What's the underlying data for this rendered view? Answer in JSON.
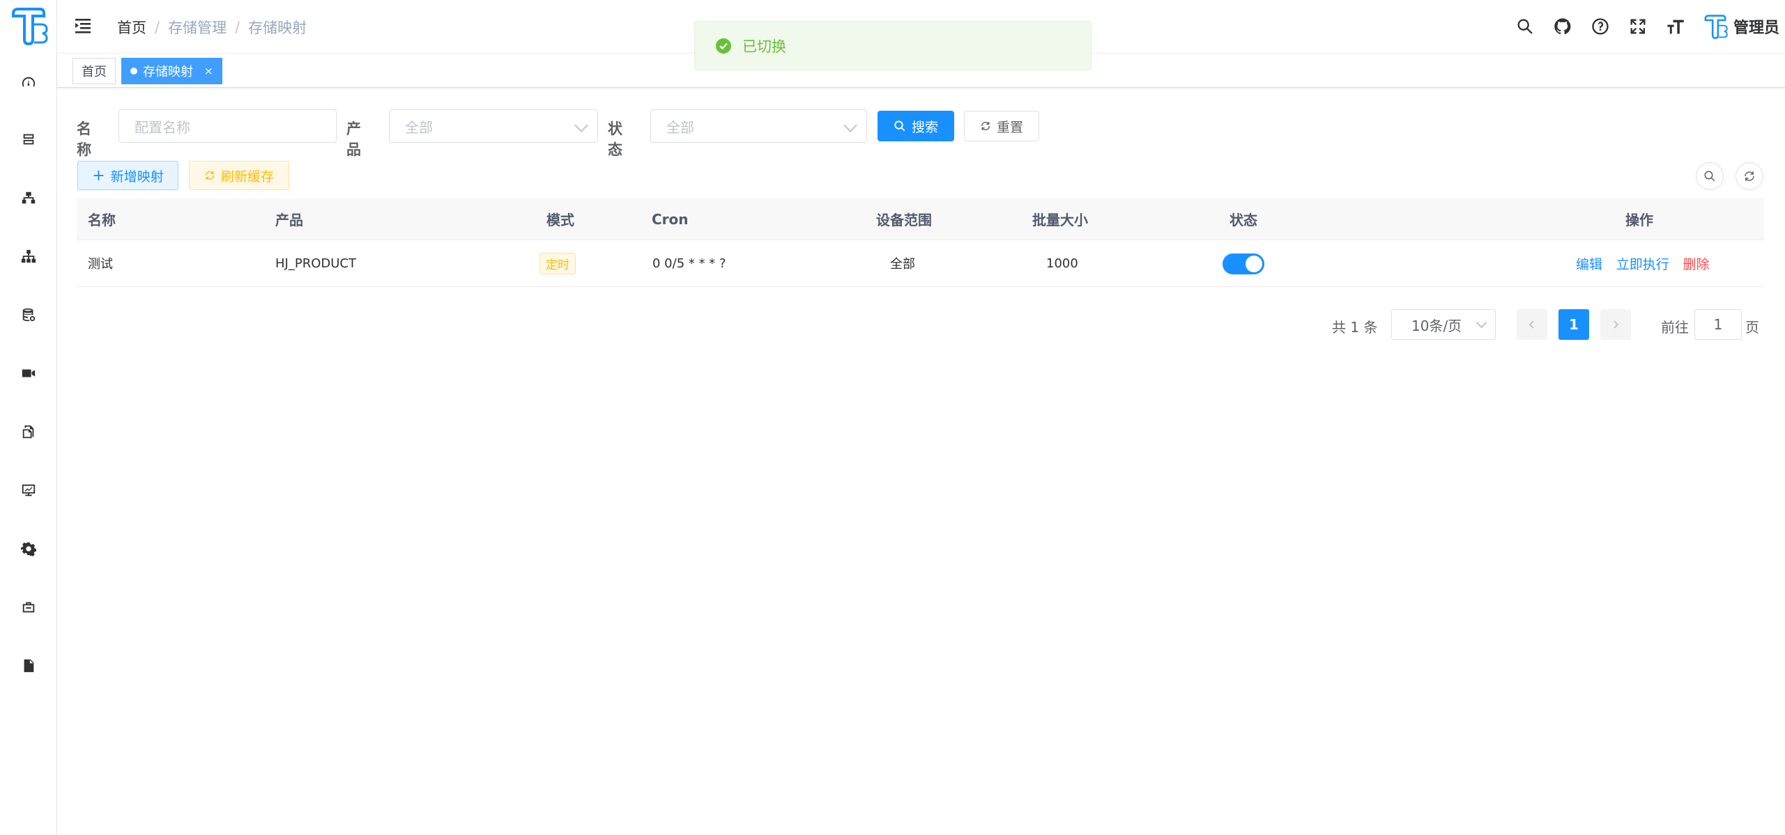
{
  "header": {
    "breadcrumb": [
      "首页",
      "存储管理",
      "存储映射"
    ],
    "separator": "/",
    "user_name": "管理员"
  },
  "tags": {
    "home": "首页",
    "active": "存储映射",
    "close": "×"
  },
  "sidebar": {
    "icons": [
      "dashboard-icon",
      "server-icon",
      "network-icon",
      "sitemap-icon",
      "database-icon",
      "video-icon",
      "files-icon",
      "monitor-icon",
      "settings-icon",
      "toolbox-icon",
      "document-icon"
    ]
  },
  "toast": {
    "message": "已切换",
    "color": "#67c23a"
  },
  "filters": {
    "name_label": "名称",
    "name_placeholder": "配置名称",
    "product_label": "产品",
    "product_value": "全部",
    "status_label": "状态",
    "status_value": "全部",
    "search_label": "搜索",
    "reset_label": "重置"
  },
  "toolbar": {
    "add_label": "新增映射",
    "refresh_label": "刷新缓存"
  },
  "table": {
    "columns": [
      "名称",
      "产品",
      "模式",
      "Cron",
      "设备范围",
      "批量大小",
      "状态",
      "操作"
    ],
    "rows": [
      {
        "name": "测试",
        "product": "HJ_PRODUCT",
        "mode": "定时",
        "cron": "0 0/5 * * * ?",
        "scope": "全部",
        "batch": "1000",
        "enabled": true,
        "actions": [
          "编辑",
          "立即执行",
          "删除"
        ]
      }
    ]
  },
  "pagination": {
    "total": "共 1 条",
    "page_size": "10条/页",
    "current": "1",
    "goto_label": "前往",
    "goto_value": "1",
    "page_suffix": "页"
  },
  "colors": {
    "primary": "#1890ff",
    "success": "#67c23a",
    "warning": "#ffba00",
    "danger": "#ff4949"
  }
}
